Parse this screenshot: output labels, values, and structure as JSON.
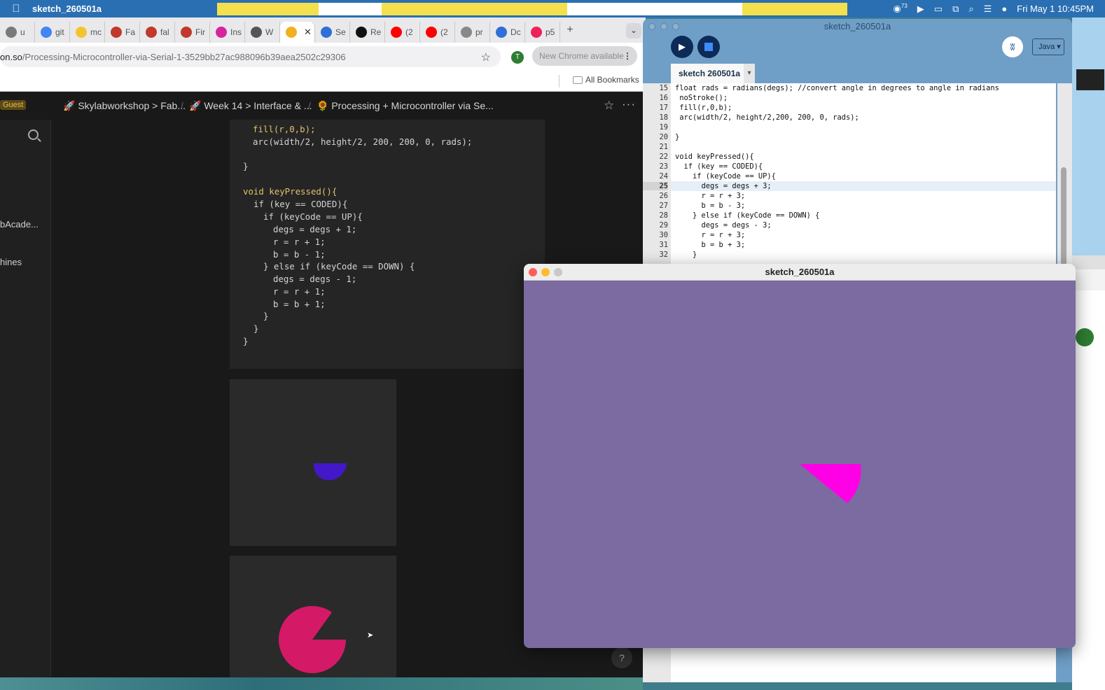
{
  "menubar": {
    "apple": "",
    "app_name": "sketch_260501a",
    "datetime": "Fri May 1  10:45PM",
    "notif_badge": "73",
    "icons": [
      "copilot-icon",
      "play-circle-icon",
      "battery-icon",
      "screen-mirror-icon",
      "spotlight-icon",
      "control-center-icon",
      "siri-icon"
    ]
  },
  "chrome": {
    "tabs": [
      {
        "label": "u",
        "favicon": "generic-tab-icon",
        "color": "#7a7a7a"
      },
      {
        "label": "git",
        "favicon": "google-icon",
        "color": "#4285f4"
      },
      {
        "label": "mc",
        "favicon": "emoji-sunglasses-icon",
        "color": "#f4c430"
      },
      {
        "label": "Fa",
        "favicon": "fab-academy-icon",
        "color": "#c0392b"
      },
      {
        "label": "fal",
        "favicon": "fab-academy-icon",
        "color": "#c0392b"
      },
      {
        "label": "Fir",
        "favicon": "fab-academy-icon",
        "color": "#c0392b"
      },
      {
        "label": "Ins",
        "favicon": "instagram-icon",
        "color": "#d6249f"
      },
      {
        "label": "W",
        "favicon": "globe-icon",
        "color": "#555555"
      },
      {
        "label": "",
        "favicon": "sunflower-icon",
        "color": "#f2b01e",
        "active": true
      },
      {
        "label": "Se",
        "favicon": "edge-icon",
        "color": "#2f6fd6"
      },
      {
        "label": "Re",
        "favicon": "github-icon",
        "color": "#111111"
      },
      {
        "label": "(2",
        "favicon": "youtube-icon",
        "color": "#ff0000"
      },
      {
        "label": "(2",
        "favicon": "youtube-icon",
        "color": "#ff0000"
      },
      {
        "label": "pr",
        "favicon": "processing-icon",
        "color": "#888888"
      },
      {
        "label": "Dc",
        "favicon": "edge-icon",
        "color": "#2f6fd6"
      },
      {
        "label": "p5",
        "favicon": "p5-star-icon",
        "color": "#ed225d"
      }
    ],
    "url_host": "on.so",
    "url_path": "/Processing-Microcontroller-via-Serial-1-3529bb27ac988096b39aea2502c29306",
    "profile_initial": "T",
    "update_label": "New Chrome available",
    "bookmarks_label": "All Bookmarks"
  },
  "notion": {
    "guest_label": "Guest",
    "breadcrumbs": [
      {
        "icon": "🚀",
        "text": "Skylabworkshop > Fab..."
      },
      {
        "icon": "🚀",
        "text": "Week 14 > Interface & ..."
      },
      {
        "icon": "🌻",
        "text": "Processing + Microcontroller via Se..."
      }
    ],
    "sidebar_items": [
      "bAcade...",
      "hines"
    ],
    "code": [
      "fill(r,0,b);",
      "arc(width/2, height/2, 200, 200, 0, rads);",
      "}",
      "void keyPressed(){",
      "if (key == CODED){",
      "if (keyCode == UP){",
      "degs = degs + 1;",
      "r = r + 1;",
      "b = b - 1;",
      "} else if (keyCode == DOWN) {",
      "degs = degs - 1;",
      "r = r + 1;",
      "b = b + 1;",
      "}",
      "}",
      "}"
    ],
    "help_label": "?"
  },
  "ide": {
    "title": "sketch_260501a",
    "tab_label": "sketch 260501a",
    "mode_label": "Java ▾",
    "lines": [
      {
        "n": "15",
        "t": "float rads = radians(degs); //convert angle in degrees to angle in radians"
      },
      {
        "n": "16",
        "t": " noStroke();"
      },
      {
        "n": "17",
        "t": " fill(r,0,b);"
      },
      {
        "n": "18",
        "t": " arc(width/2, height/2,200, 200, 0, rads);"
      },
      {
        "n": "19",
        "t": ""
      },
      {
        "n": "20",
        "t": "}"
      },
      {
        "n": "21",
        "t": ""
      },
      {
        "n": "22",
        "t": "void keyPressed(){"
      },
      {
        "n": "23",
        "t": "  if (key == CODED){"
      },
      {
        "n": "24",
        "t": "    if (keyCode == UP){"
      },
      {
        "n": "25",
        "t": "      degs = degs + 3;"
      },
      {
        "n": "26",
        "t": "      r = r + 3;"
      },
      {
        "n": "27",
        "t": "      b = b - 3;"
      },
      {
        "n": "28",
        "t": "    } else if (keyCode == DOWN) {"
      },
      {
        "n": "29",
        "t": "      degs = degs - 3;"
      },
      {
        "n": "30",
        "t": "      r = r + 3;"
      },
      {
        "n": "31",
        "t": "      b = b + 3;"
      },
      {
        "n": "32",
        "t": "    }"
      }
    ],
    "current_line": "25"
  },
  "sketch": {
    "title": "sketch_260501a",
    "background": "#7b6ba0",
    "arc_color": "#ff00e6"
  },
  "colors": {
    "menubar": "#2a6fb2",
    "notion_bg": "#191919",
    "preview_arc_small": "#4218c9",
    "preview_arc_large": "#d41a66"
  }
}
